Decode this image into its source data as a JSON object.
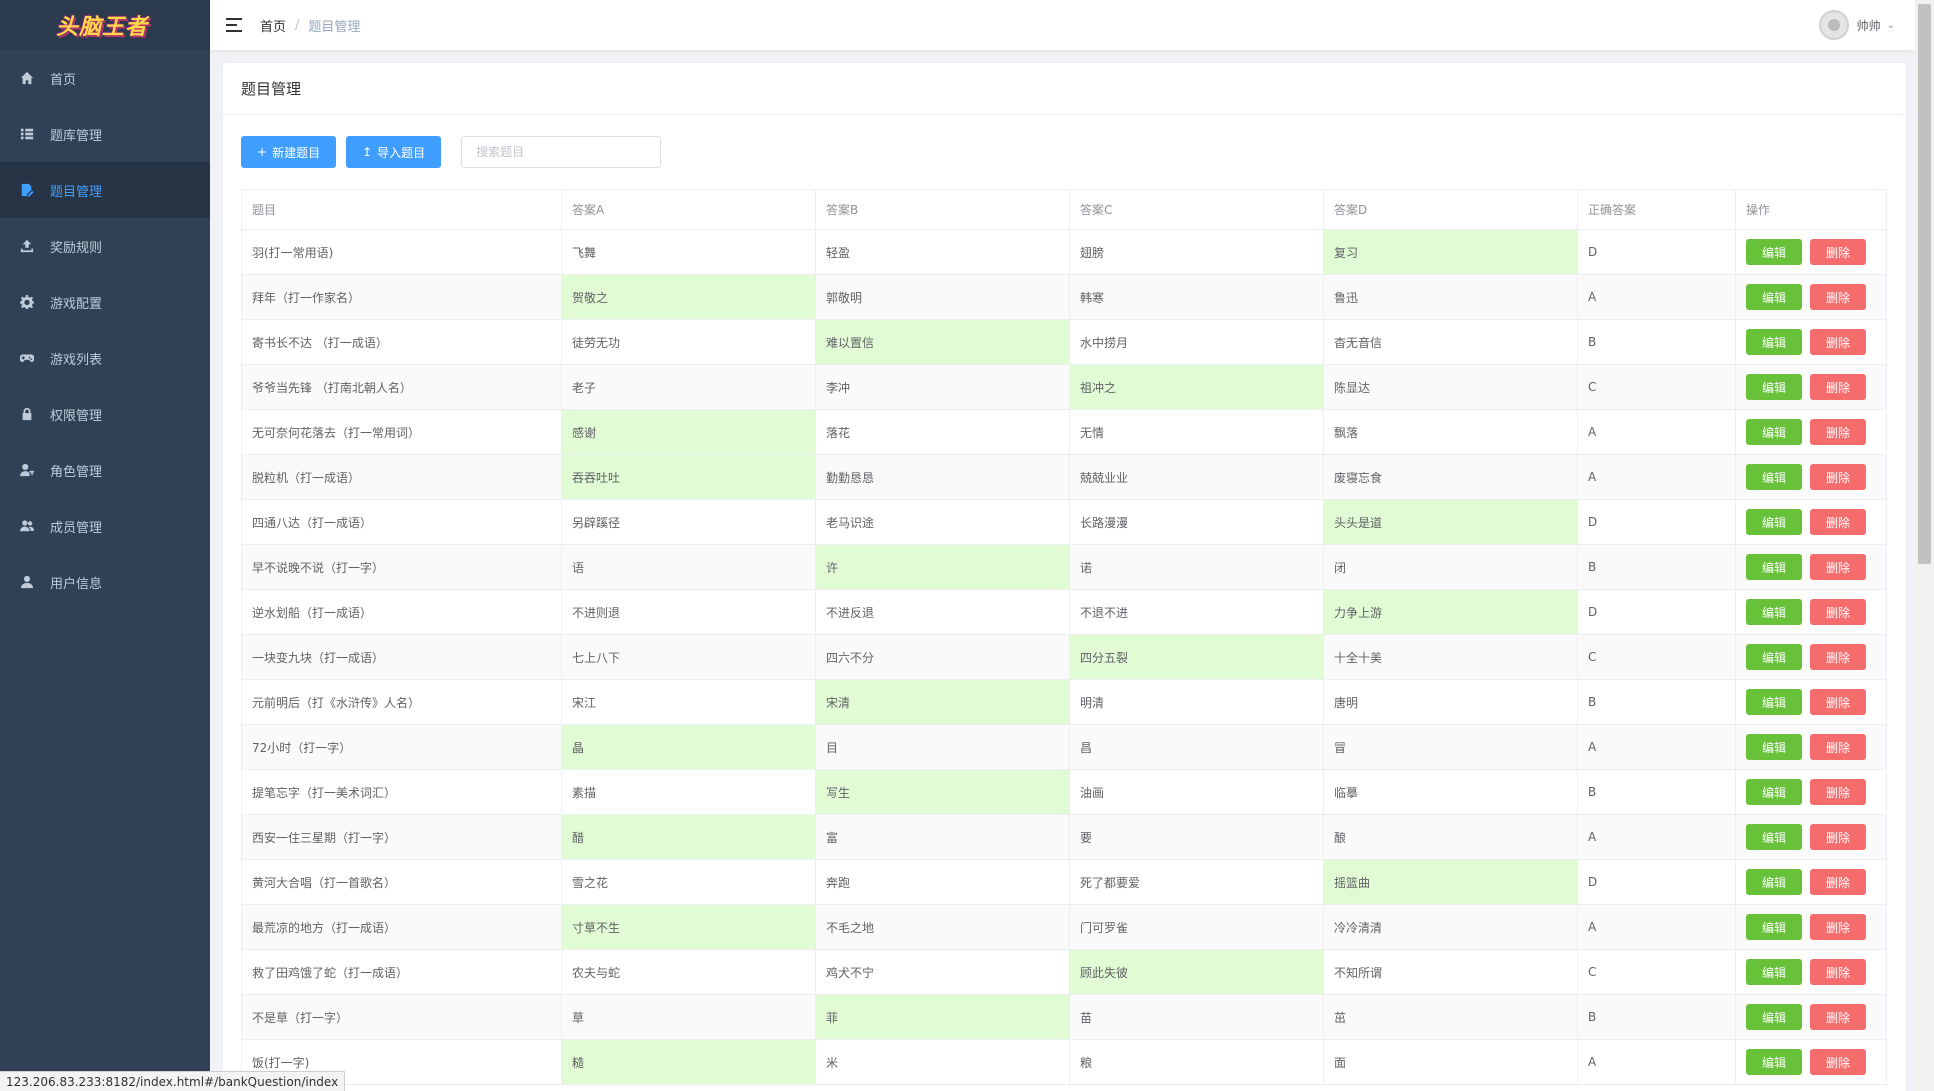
{
  "logo": {
    "text": "头脑王者"
  },
  "sidebar": {
    "items": [
      {
        "label": "首页",
        "icon": "home-icon",
        "active": false
      },
      {
        "label": "题库管理",
        "icon": "list-icon",
        "active": false
      },
      {
        "label": "题目管理",
        "icon": "document-edit-icon",
        "active": true
      },
      {
        "label": "奖励规则",
        "icon": "upload-icon",
        "active": false
      },
      {
        "label": "游戏配置",
        "icon": "gear-icon",
        "active": false
      },
      {
        "label": "游戏列表",
        "icon": "gamepad-icon",
        "active": false
      },
      {
        "label": "权限管理",
        "icon": "lock-icon",
        "active": false
      },
      {
        "label": "角色管理",
        "icon": "user-key-icon",
        "active": false
      },
      {
        "label": "成员管理",
        "icon": "users-icon",
        "active": false
      },
      {
        "label": "用户信息",
        "icon": "user-icon",
        "active": false
      }
    ]
  },
  "navbar": {
    "breadcrumb": {
      "home": "首页",
      "separator": "/",
      "current": "题目管理"
    },
    "user": {
      "name": "帅帅"
    }
  },
  "card": {
    "title": "题目管理"
  },
  "toolbar": {
    "new_label": "新建题目",
    "import_label": "导入题目",
    "search_placeholder": "搜索题目"
  },
  "table": {
    "columns": [
      "题目",
      "答案A",
      "答案B",
      "答案C",
      "答案D",
      "正确答案",
      "操作"
    ],
    "edit_label": "编辑",
    "delete_label": "删除",
    "correct_color": "#e1fcd4",
    "rows": [
      {
        "q": "羽(打一常用语)",
        "a": "飞舞",
        "b": "轻盈",
        "c": "翅膀",
        "d": "复习",
        "ans": "D"
      },
      {
        "q": "拜年（打一作家名）",
        "a": "贺敬之",
        "b": "郭敬明",
        "c": "韩寒",
        "d": "鲁迅",
        "ans": "A"
      },
      {
        "q": "寄书长不达 （打一成语）",
        "a": "徒劳无功",
        "b": "难以置信",
        "c": "水中捞月",
        "d": "杳无音信",
        "ans": "B"
      },
      {
        "q": "爷爷当先锋 （打南北朝人名）",
        "a": "老子",
        "b": "李冲",
        "c": "祖冲之",
        "d": "陈显达",
        "ans": "C"
      },
      {
        "q": "无可奈何花落去（打一常用词）",
        "a": "感谢",
        "b": "落花",
        "c": "无情",
        "d": "飘落",
        "ans": "A"
      },
      {
        "q": "脱粒机（打一成语）",
        "a": "吞吞吐吐",
        "b": "勤勤恳恳",
        "c": "兢兢业业",
        "d": "废寝忘食",
        "ans": "A"
      },
      {
        "q": " 四通八达（打一成语）",
        "a": "另辟蹊径",
        "b": "老马识途",
        "c": "长路漫漫",
        "d": "头头是道",
        "ans": "D"
      },
      {
        "q": "早不说晚不说（打一字）",
        "a": "语",
        "b": "许",
        "c": "诺",
        "d": "闭",
        "ans": "B"
      },
      {
        "q": "逆水划船（打一成语）",
        "a": "不进则退",
        "b": "不进反退",
        "c": "不退不进",
        "d": "力争上游",
        "ans": "D"
      },
      {
        "q": "一块变九块（打一成语）",
        "a": "七上八下",
        "b": "四六不分",
        "c": "四分五裂",
        "d": "十全十美",
        "ans": "C"
      },
      {
        "q": "元前明后（打《水浒传》人名）",
        "a": "宋江",
        "b": "宋清",
        "c": "明清",
        "d": "唐明",
        "ans": "B"
      },
      {
        "q": "72小时（打一字）",
        "a": "晶",
        "b": "目",
        "c": "昌",
        "d": "冒",
        "ans": "A"
      },
      {
        "q": "提笔忘字（打一美术词汇）",
        "a": "素描",
        "b": "写生",
        "c": "油画",
        "d": "临摹",
        "ans": "B"
      },
      {
        "q": "西安一住三星期（打一字）",
        "a": "醋",
        "b": "富",
        "c": "要",
        "d": "酿",
        "ans": "A"
      },
      {
        "q": "黄河大合唱（打一首歌名）",
        "a": "雪之花",
        "b": "奔跑",
        "c": "死了都要爱",
        "d": "摇篮曲",
        "ans": "D"
      },
      {
        "q": "最荒凉的地方（打一成语）",
        "a": "寸草不生",
        "b": "不毛之地",
        "c": "门可罗雀",
        "d": "冷冷清清",
        "ans": "A"
      },
      {
        "q": "救了田鸡饿了蛇（打一成语）",
        "a": "农夫与蛇",
        "b": "鸡犬不宁",
        "c": "顾此失彼",
        "d": "不知所谓",
        "ans": "C"
      },
      {
        "q": "不是草（打一字）",
        "a": "草",
        "b": "菲",
        "c": "苗",
        "d": "茁",
        "ans": "B"
      },
      {
        "q": "饭(打一字)",
        "a": "糙",
        "b": "米",
        "c": "粮",
        "d": "面",
        "ans": "A"
      }
    ]
  },
  "statusbar": {
    "url": "123.206.83.233:8182/index.html#/bankQuestion/index"
  }
}
